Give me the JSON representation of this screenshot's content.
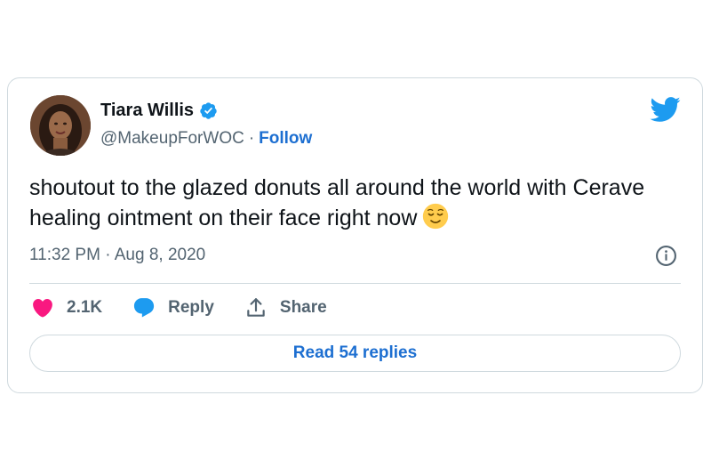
{
  "author": {
    "name": "Tiara Willis",
    "handle": "@MakeupForWOC",
    "separator": "·",
    "follow_label": "Follow",
    "verified": true
  },
  "tweet": {
    "text": "shoutout to the glazed donuts all around the world with Cerave healing ointment on their face right now",
    "emoji": "relieved-face",
    "timestamp": "11:32 PM · Aug 8, 2020"
  },
  "actions": {
    "like_count": "2.1K",
    "reply_label": "Reply",
    "share_label": "Share"
  },
  "read_replies_label": "Read 54 replies",
  "colors": {
    "brand_blue": "#1d9bf0",
    "link_blue": "#1d6fd1",
    "heart_pink": "#f91880",
    "muted_text": "#536471",
    "border": "#cfd9de"
  },
  "icons": [
    "avatar",
    "verified-icon",
    "twitter-bird-icon",
    "relieved-face-emoji",
    "info-icon",
    "heart-icon",
    "reply-bubble-icon",
    "share-icon"
  ]
}
